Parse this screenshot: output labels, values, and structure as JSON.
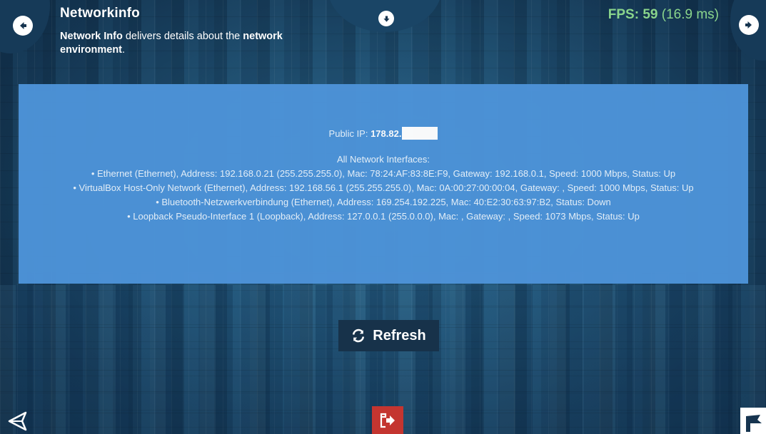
{
  "header": {
    "title": "Networkinfo",
    "subtitle_part1": "Network Info",
    "subtitle_part2": " delivers details about the ",
    "subtitle_part3": "network environment",
    "subtitle_part4": "."
  },
  "fps": {
    "label": "FPS: 59",
    "ms": "(16.9 ms)",
    "color": "#8ad58c"
  },
  "info": {
    "public_ip_label": "Public IP: ",
    "public_ip_value": "178.82.",
    "interfaces_heading": "All Network Interfaces:",
    "interfaces": [
      "• Ethernet (Ethernet), Address: 192.168.0.21 (255.255.255.0), Mac: 78:24:AF:83:8E:F9, Gateway: 192.168.0.1, Speed: 1000 Mbps, Status: Up",
      "• VirtualBox Host-Only Network (Ethernet), Address: 192.168.56.1 (255.255.255.0), Mac: 0A:00:27:00:00:04, Gateway: , Speed: 1000 Mbps, Status: Up",
      "• Bluetooth-Netzwerkverbindung (Ethernet), Address: 169.254.192.225, Mac: 40:E2:30:63:97:B2, Status: Down",
      "• Loopback Pseudo-Interface 1 (Loopback), Address: 127.0.0.1 (255.0.0.0), Mac: , Gateway: , Speed: 1073 Mbps, Status: Up"
    ]
  },
  "buttons": {
    "refresh_label": "Refresh"
  },
  "icons": {
    "back": "arrow-left-circle-icon",
    "next": "arrow-right-circle-icon",
    "toggle": "arrow-down-circle-icon",
    "refresh": "refresh-icon",
    "unity": "unity-logo-icon",
    "exit": "exit-icon",
    "logo": "flag-logo-icon"
  },
  "colors": {
    "panel": "#4d93d8",
    "exit_button": "#c43530",
    "refresh_button": "#17324a"
  }
}
